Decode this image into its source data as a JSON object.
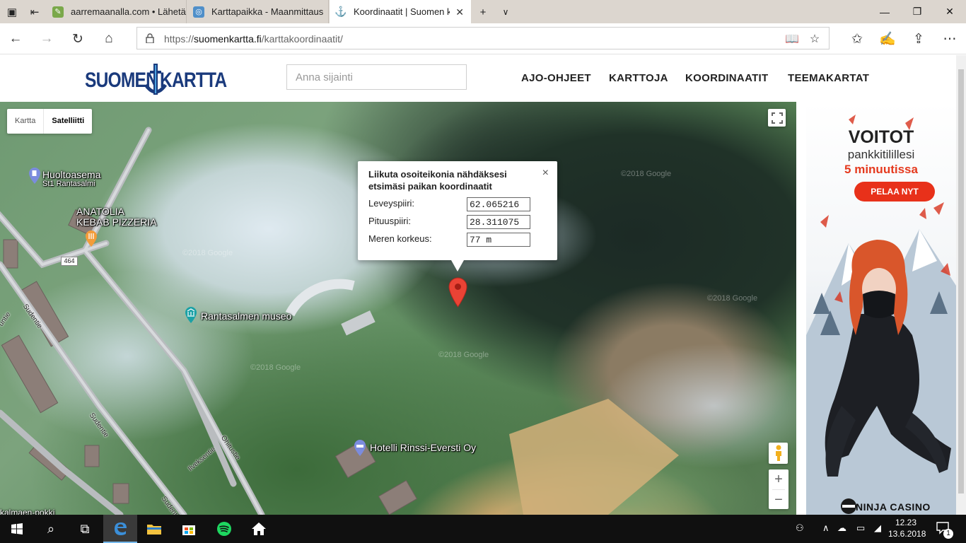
{
  "browser": {
    "tabs": [
      {
        "label": "aarremaanalla.com • Lähetä",
        "icon": "leaf-favicon-icon"
      },
      {
        "label": "Karttapaikka - Maanmittaus",
        "icon": "globe-favicon-icon"
      },
      {
        "label": "Koordinaatit | Suomen k",
        "icon": "anchor-favicon-icon"
      }
    ],
    "address": {
      "prefix": "https://",
      "domain": "suomenkartta.fi",
      "path": "/karttakoordinaatit/"
    }
  },
  "site": {
    "logo": {
      "left": "SUOMEN",
      "right": "KARTTA"
    },
    "search_placeholder": "Anna sijainti",
    "nav": [
      "AJO-OHJEET",
      "KARTTOJA",
      "KOORDINAATIT",
      "TEEMAKARTAT"
    ]
  },
  "map": {
    "types": [
      "Kartta",
      "Satelliitti"
    ],
    "selected_type": "Satelliitti",
    "pois": [
      {
        "name": "Huoltoasema",
        "sub": "St1 Rantasalmi",
        "icon": "gas-station-pin-icon"
      },
      {
        "name": "ANATOLIA\nKEBAB PIZZERIA",
        "icon": "restaurant-pin-icon"
      },
      {
        "name": "Rantasalmen museo",
        "icon": "museum-pin-icon"
      },
      {
        "name": "Hotelli Rinssi-Eversti Oy",
        "icon": "hotel-pin-icon"
      }
    ],
    "streets": [
      "Sudentie",
      "Sudentie",
      "Ohitustie",
      "Ilveksentie",
      "untie",
      "Sudentie"
    ],
    "road_number": "464",
    "partial_label": "kalmaen-pokki",
    "watermark": "©2018 Google",
    "infowindow": {
      "title": "Liikuta osoiteikonia nähdäksesi etsimäsi paikan koordinaatit",
      "rows": [
        {
          "label": "Leveyspiiri:",
          "value": "62.065216"
        },
        {
          "label": "Pituuspiiri:",
          "value": "28.311075"
        },
        {
          "label": "Meren korkeus:",
          "value": "77 m"
        }
      ],
      "close": "×"
    },
    "zoom_in": "+",
    "zoom_out": "−"
  },
  "ad": {
    "headline": "VOITOT",
    "line2": "pankkitilillesi",
    "line3": "5 minuutissa",
    "cta": "PELAA NYT",
    "brand": "NINJA CASINO",
    "colors": {
      "accent": "#e8311a"
    }
  },
  "taskbar": {
    "time": "12.23",
    "date": "13.6.2018",
    "notification_count": "1"
  }
}
